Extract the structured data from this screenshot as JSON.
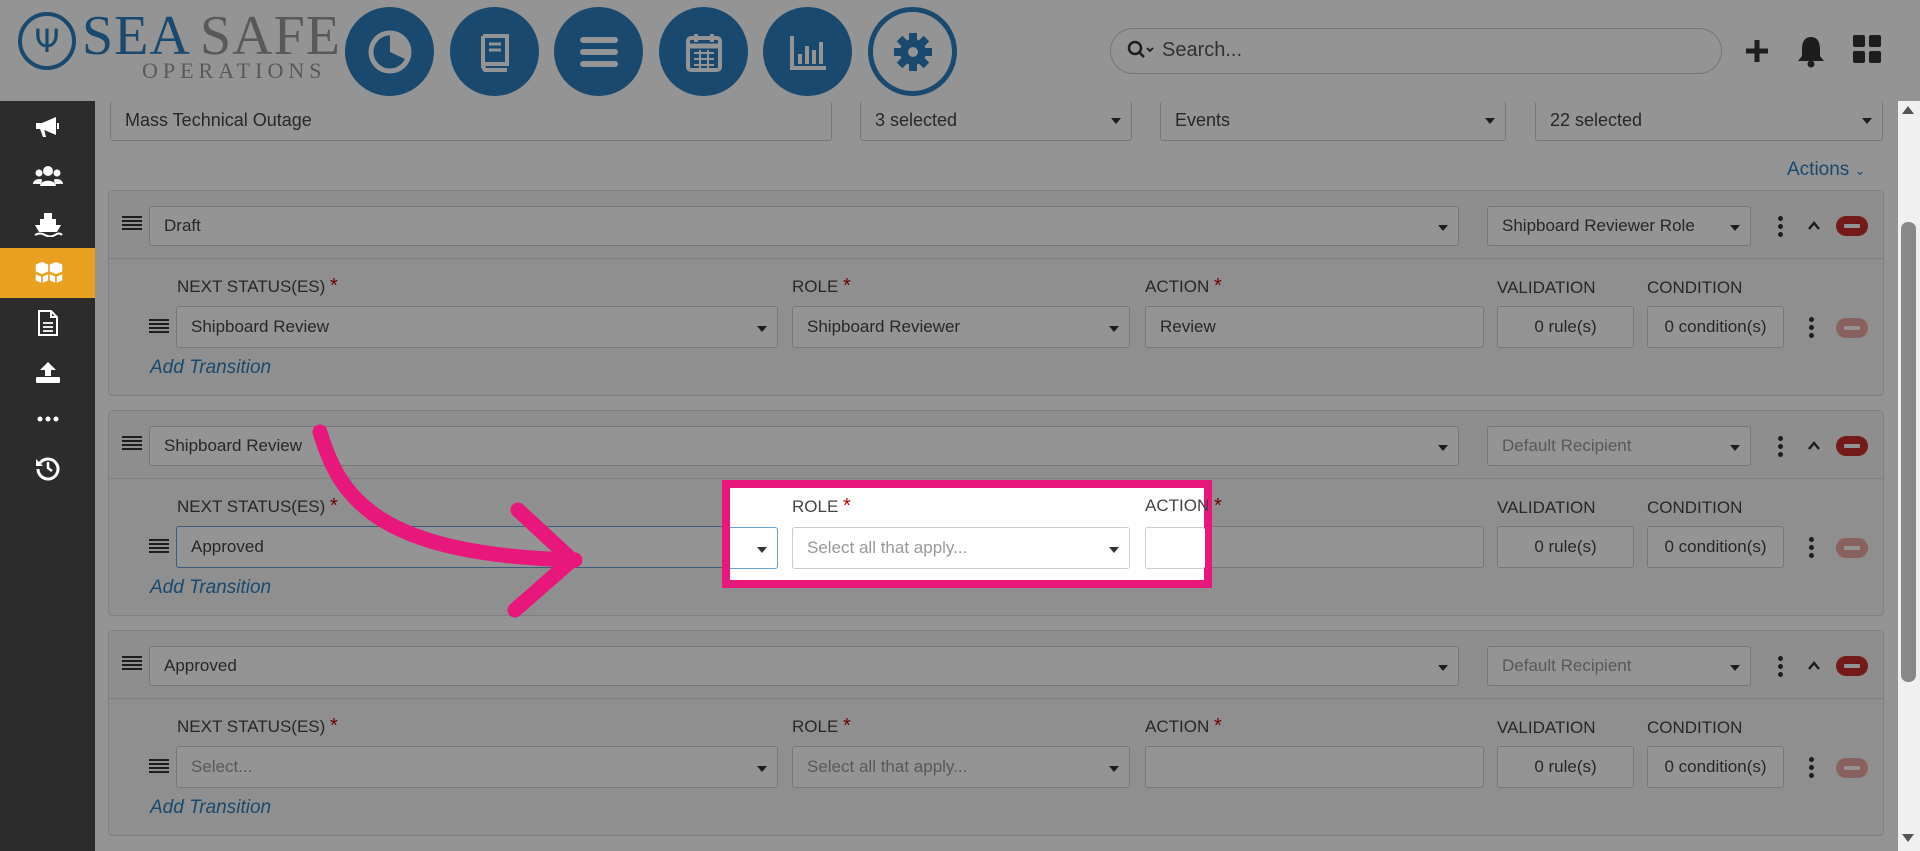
{
  "brand": {
    "sea": "SEA",
    "safe": "SAFE",
    "operations": "OPERATIONS"
  },
  "nav": [
    {
      "name": "dashboard",
      "icon": "pie-chart-icon"
    },
    {
      "name": "documents",
      "icon": "book-icon"
    },
    {
      "name": "menu",
      "icon": "list-icon"
    },
    {
      "name": "calendar",
      "icon": "calendar-icon"
    },
    {
      "name": "reports",
      "icon": "bar-chart-icon"
    },
    {
      "name": "settings",
      "icon": "gear-icon",
      "active": true
    }
  ],
  "search": {
    "placeholder": "Search..."
  },
  "filters": {
    "name": "Mass Technical Outage",
    "select1": "3 selected",
    "select2": "Events",
    "select3": "22 selected"
  },
  "actions_label": "Actions",
  "labels": {
    "next_status": "NEXT STATUS(ES)",
    "role": "ROLE",
    "action": "ACTION",
    "validation": "VALIDATION",
    "condition": "CONDITION",
    "add_transition": "Add Transition",
    "required": "*"
  },
  "statuses": [
    {
      "status": "Draft",
      "recipient": "Shipboard Reviewer Role",
      "transition": {
        "next": "Shipboard Review",
        "role": "Shipboard Reviewer",
        "action": "Review",
        "validation": "0 rule(s)",
        "condition": "0 condition(s)"
      }
    },
    {
      "status": "Shipboard Review",
      "recipient": "Default Recipient",
      "transition": {
        "next": "Approved",
        "role": "Select all that apply...",
        "action": "",
        "validation": "0 rule(s)",
        "condition": "0 condition(s)"
      }
    },
    {
      "status": "Approved",
      "recipient": "Default Recipient",
      "transition": {
        "next": "Select...",
        "role": "Select all that apply...",
        "action": "",
        "validation": "0 rule(s)",
        "condition": "0 condition(s)"
      }
    }
  ],
  "colors": {
    "brand_blue": "#2b7fbd",
    "highlight": "#e8177b",
    "sidebar_active": "#e8a020",
    "danger": "#c9302c"
  }
}
